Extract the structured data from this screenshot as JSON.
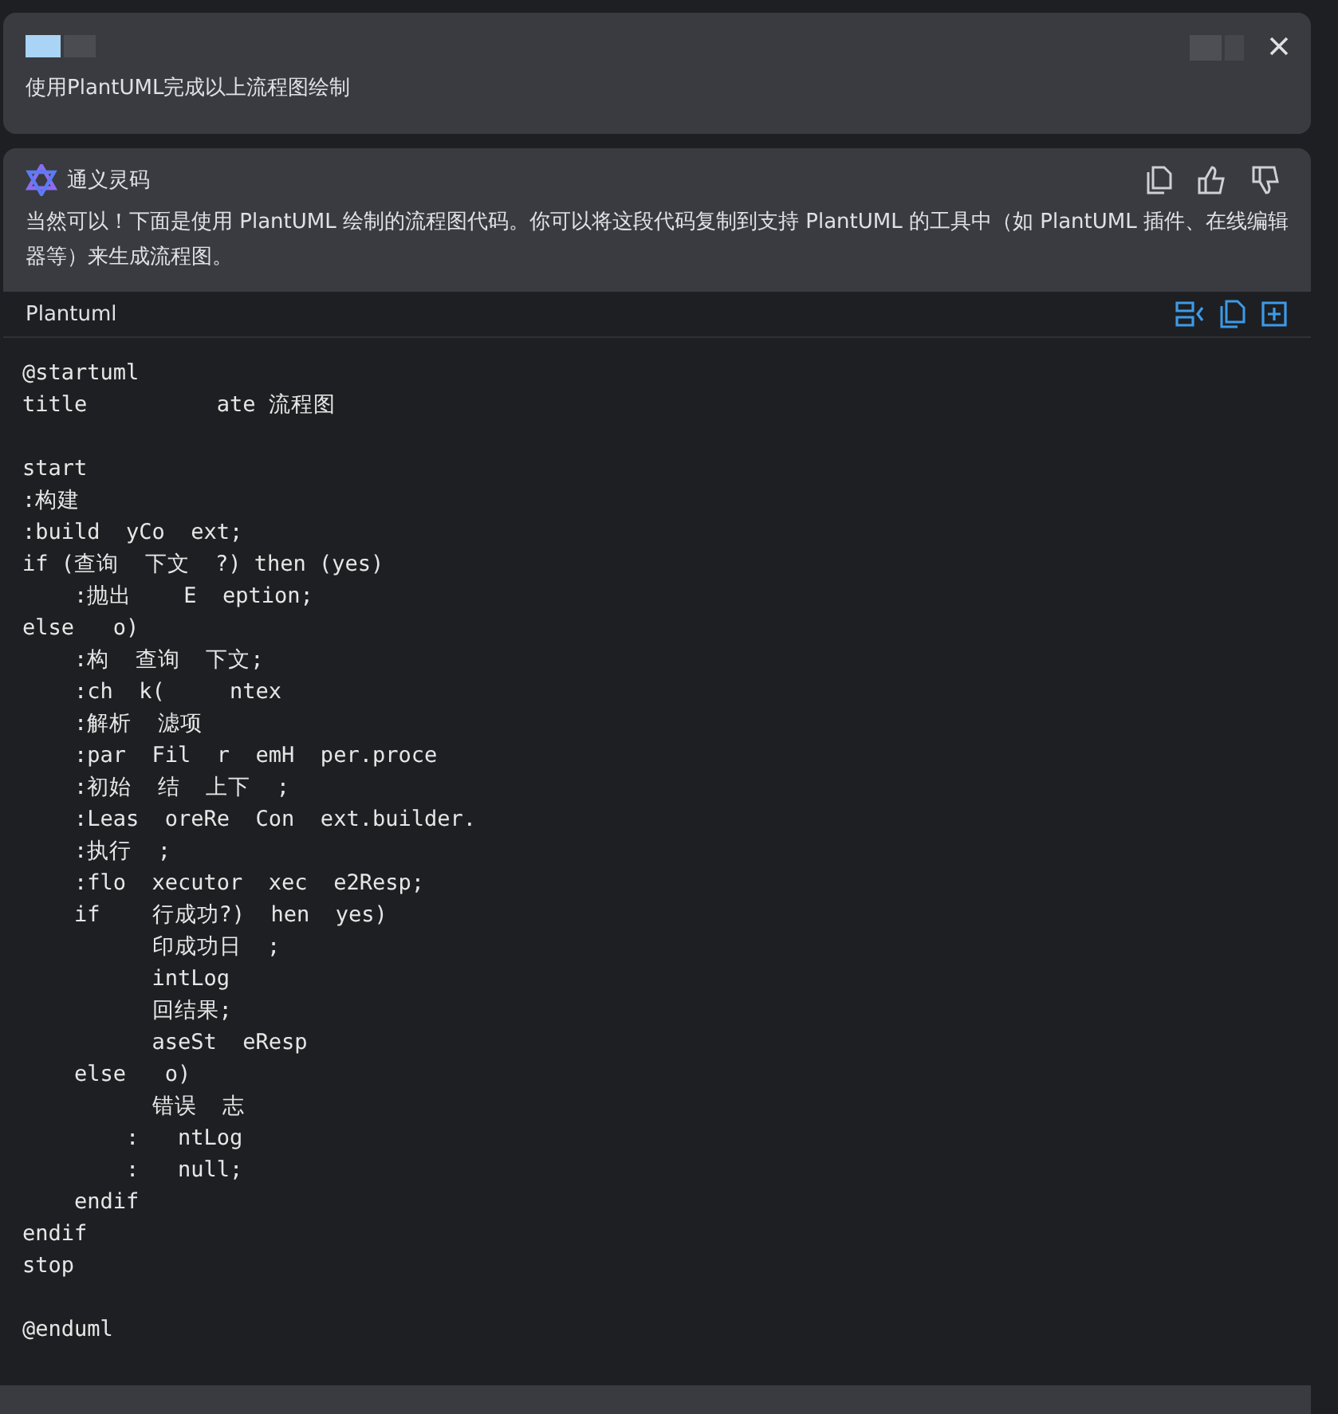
{
  "user_message": {
    "text": "使用PlantUML完成以上流程图绘制"
  },
  "reply": {
    "author": "通义灵码",
    "text": "当然可以！下面是使用 PlantUML 绘制的流程图代码。你可以将这段代码复制到支持 PlantUML 的工具中（如 PlantUML 插件、在线编辑器等）来生成流程图。",
    "code_block": {
      "language": "Plantuml",
      "blocks": [
        [
          "@startuml",
          "title          ate 流程图"
        ],
        [
          "start",
          ":构建",
          ":build  yCo  ext;",
          "if (查询  下文  ?) then (yes)",
          "    :抛出    E  eption;",
          "else   o)",
          "    :构  查询  下文;",
          "    :ch  k(     ntex",
          "    :解析  滤项",
          "    :par  Fil  r  emH  per.proce",
          "    :初始  结  上下  ;",
          "    :Leas  oreRe  Con  ext.builder.",
          "    :执行  ;",
          "    :flo  xecutor  xec  e2Resp;",
          "    if    行成功?)  hen  yes)",
          "          印成功日  ;",
          "          intLog",
          "          回结果;",
          "          aseSt  eResp",
          "    else   o)",
          "          错误  志",
          "        :   ntLog",
          "        :   null;",
          "    endif",
          "endif",
          "stop"
        ],
        [
          "@enduml"
        ]
      ]
    }
  }
}
